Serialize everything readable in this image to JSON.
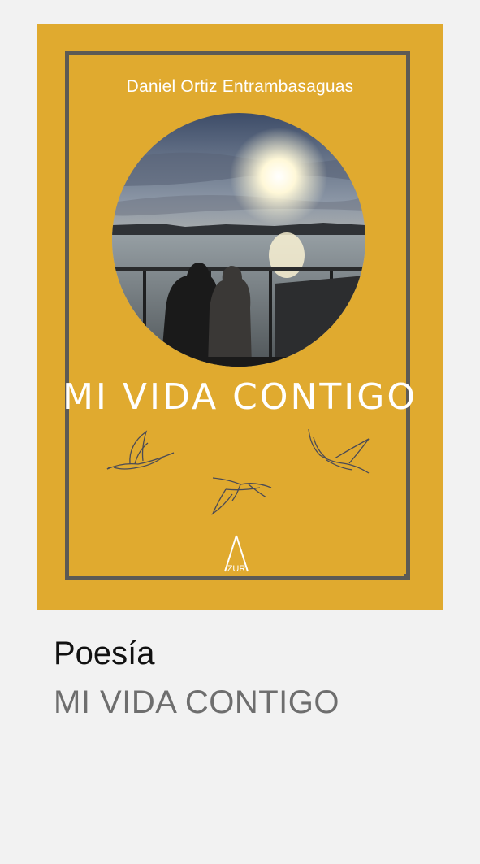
{
  "book": {
    "cover": {
      "author": "Daniel Ortiz Entrambasaguas",
      "title": "MI VIDA CONTIGO",
      "publisher_mark": "ZUR",
      "background_color": "#e0aa2f",
      "frame_color": "#5c5a55",
      "photo_description_icon": "couple-at-sunset-photo",
      "decorations": [
        "seagull-icon",
        "seagull-icon",
        "seagull-icon"
      ]
    },
    "category": "Poesía",
    "title": "MI VIDA CONTIGO"
  }
}
